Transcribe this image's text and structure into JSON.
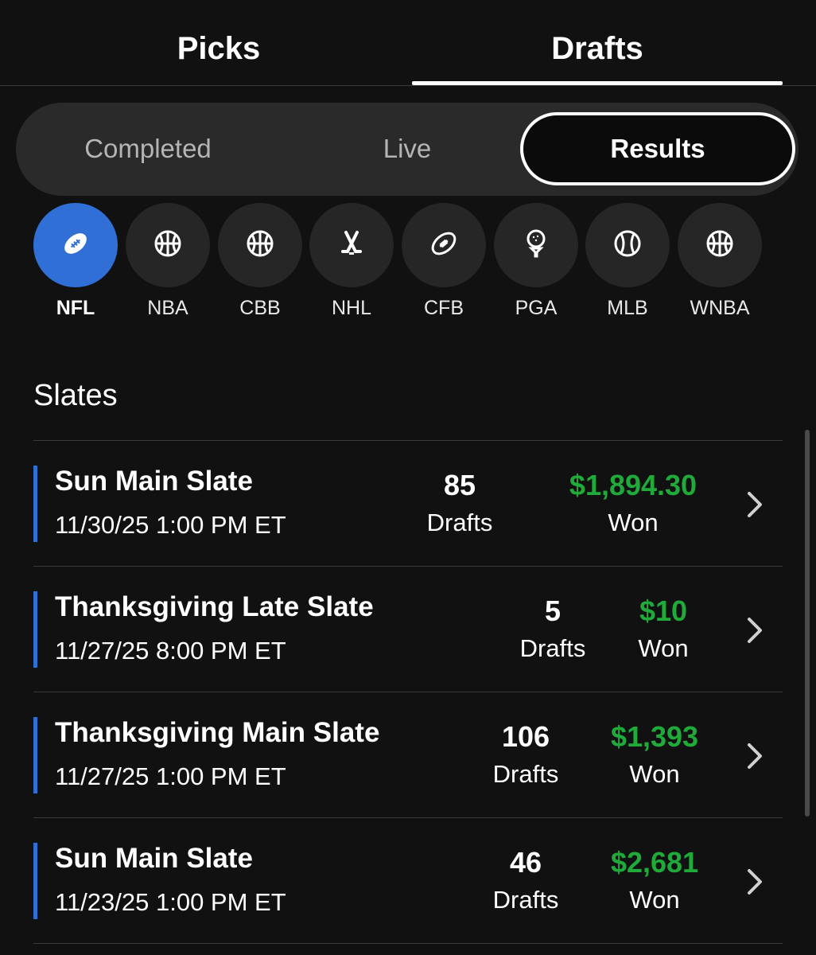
{
  "top_tabs": {
    "picks": "Picks",
    "drafts": "Drafts"
  },
  "segments": {
    "completed": "Completed",
    "live": "Live",
    "results": "Results"
  },
  "sports": [
    {
      "label": "NFL",
      "icon": "football-icon"
    },
    {
      "label": "NBA",
      "icon": "basketball-icon"
    },
    {
      "label": "CBB",
      "icon": "basketball-icon"
    },
    {
      "label": "NHL",
      "icon": "hockey-sticks-icon"
    },
    {
      "label": "CFB",
      "icon": "football-icon"
    },
    {
      "label": "PGA",
      "icon": "golf-ball-icon"
    },
    {
      "label": "MLB",
      "icon": "baseball-icon"
    },
    {
      "label": "WNBA",
      "icon": "basketball-icon"
    }
  ],
  "slates": {
    "title": "Slates",
    "rows": [
      {
        "name": "Sun Main Slate",
        "date": "11/30/25 1:00 PM ET",
        "drafts": "85",
        "drafts_label": "Drafts",
        "won": "$1,894.30",
        "won_label": "Won"
      },
      {
        "name": "Thanksgiving Late Slate",
        "date": "11/27/25 8:00 PM ET",
        "drafts": "5",
        "drafts_label": "Drafts",
        "won": "$10",
        "won_label": "Won"
      },
      {
        "name": "Thanksgiving Main Slate",
        "date": "11/27/25 1:00 PM ET",
        "drafts": "106",
        "drafts_label": "Drafts",
        "won": "$1,393",
        "won_label": "Won"
      },
      {
        "name": "Sun Main Slate",
        "date": "11/23/25 1:00 PM ET",
        "drafts": "46",
        "drafts_label": "Drafts",
        "won": "$2,681",
        "won_label": "Won"
      }
    ]
  },
  "colors": {
    "accent_blue": "#2f6fd6",
    "won_green": "#1faa3a",
    "background": "#111111"
  }
}
